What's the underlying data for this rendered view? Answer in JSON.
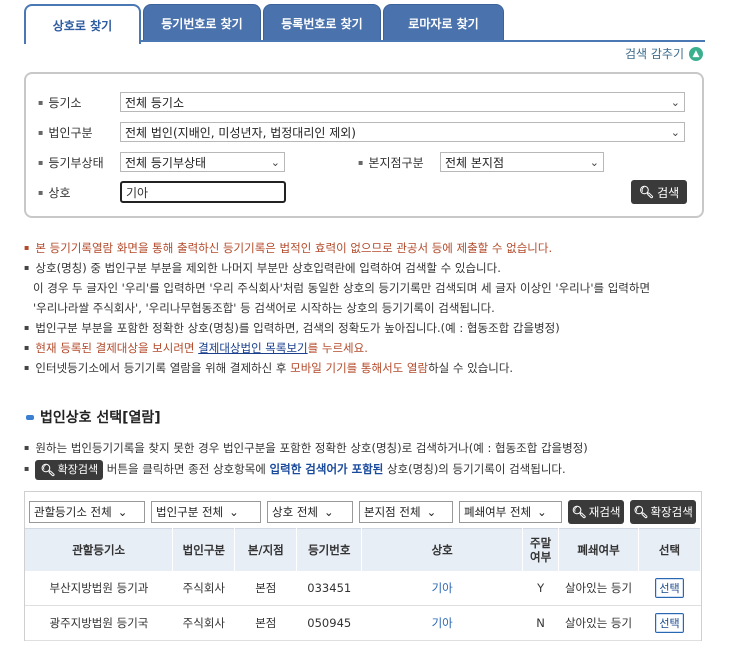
{
  "tabs": [
    {
      "label": "상호로 찾기",
      "active": true
    },
    {
      "label": "등기번호로 찾기",
      "active": false
    },
    {
      "label": "등록번호로 찾기",
      "active": false
    },
    {
      "label": "로마자로 찾기",
      "active": false
    }
  ],
  "toggle": {
    "label": "검색 감추기",
    "icon": "chevron-up-icon"
  },
  "form": {
    "registry_label": "등기소",
    "registry_value": "전체 등기소",
    "corp_type_label": "법인구분",
    "corp_type_value": "전체 법인(지배인, 미성년자, 법정대리인 제외)",
    "status_label": "등기부상태",
    "status_value": "전체 등기부상태",
    "branch_label": "본지점구분",
    "branch_value": "전체 본지점",
    "name_label": "상호",
    "name_value": "기아",
    "search_button": "검색"
  },
  "notices": {
    "n1": "본 등기기록열람 화면을 통해 출력하신 등기기록은 법적인 효력이 없으므로 관공서 등에 제출할 수 없습니다.",
    "n2": "상호(명칭) 중 법인구분 부분을 제외한 나머지 부분만 상호입력란에 입력하여 검색할 수 있습니다.",
    "n2_sub1": "이 경우 두 글자인 '우리'를 입력하면 '우리 주식회사'처럼 동일한 상호의 등기기록만 검색되며 세 글자 이상인 '우리나'를 입력하면",
    "n2_sub2": "'우리나라쌀 주식회사', '우리나무협동조합' 등 검색어로 시작하는 상호의 등기기록이 검색됩니다.",
    "n3": "법인구분 부분을 포함한 정확한 상호(명칭)를 입력하면, 검색의 정확도가 높아집니다.(예 : 협동조합 갑을병정)",
    "n4_pre": "현재 등록된 결제대상을 보시려면 ",
    "n4_link": "결제대상법인 목록보기",
    "n4_post": "를 누르세요.",
    "n5_pre": "인터넷등기소에서 등기기록 열람을 위해 결제하신 후 ",
    "n5_red": "모바일 기기를 통해서도 열람",
    "n5_post": "하실 수 있습니다."
  },
  "section": {
    "title": "법인상호 선택[열람]",
    "info1": "원하는 법인등기기록을 찾지 못한 경우 법인구분을 포함한 정확한 상호(명칭)로 검색하거나(예 : 협동조합 갑을병정)",
    "info2_btn": "확장검색",
    "info2_a": " 버튼을 클릭하면 종전 상호항목에 ",
    "info2_bold": "입력한 검색어가 포함된",
    "info2_b": " 상호(명칭)의 등기기록이 검색됩니다."
  },
  "filters": {
    "registry": "관할등기소 전체",
    "corp_type": "법인구분 전체",
    "name": "상호 전체",
    "branch": "본지점 전체",
    "closed": "폐쇄여부 전체",
    "research_button": "재검색",
    "extended_button": "확장검색"
  },
  "table": {
    "headers": [
      "관할등기소",
      "법인구분",
      "본/지점",
      "등기번호",
      "상호",
      "주말\n여부",
      "폐쇄여부",
      "선택"
    ],
    "header_weekend_1": "주말",
    "header_weekend_2": "여부",
    "rows": [
      {
        "registry": "부산지방법원 등기과",
        "corp_type": "주식회사",
        "branch": "본점",
        "number": "033451",
        "name": "기아",
        "weekend": "Y",
        "status": "살아있는 등기",
        "select": "선택"
      },
      {
        "registry": "광주지방법원 등기국",
        "corp_type": "주식회사",
        "branch": "본점",
        "number": "050945",
        "name": "기아",
        "weekend": "N",
        "status": "살아있는 등기",
        "select": "선택"
      }
    ]
  }
}
